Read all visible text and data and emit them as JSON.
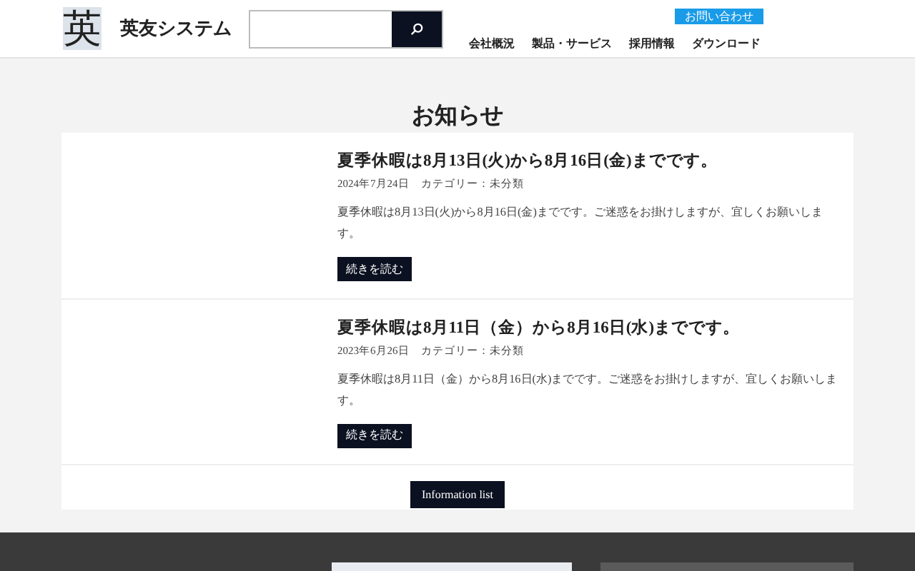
{
  "header": {
    "logo_mark": "英",
    "site_name": "英友システム",
    "contact_button": "お問い合わせ",
    "nav": [
      "会社概況",
      "製品・サービス",
      "採用情報",
      "ダウンロード"
    ]
  },
  "page_title": "お知らせ",
  "posts": [
    {
      "title": "夏季休暇は8月13日(火)から8月16日(金)までです。",
      "date": "2024年7月24日",
      "category": "カテゴリー：未分類",
      "excerpt": "夏季休暇は8月13日(火)から8月16日(金)までです。ご迷惑をお掛けしますが、宜しくお願いします。",
      "button": "続きを読む"
    },
    {
      "title": "夏季休暇は8月11日（金）から8月16日(水)までです。",
      "date": "2023年6月26日",
      "category": "カテゴリー：未分類",
      "excerpt": "夏季休暇は8月11日（金）から8月16日(水)までです。ご迷惑をお掛けしますが、宜しくお願いします。",
      "button": "続きを読む"
    }
  ],
  "list_button": "Information list"
}
